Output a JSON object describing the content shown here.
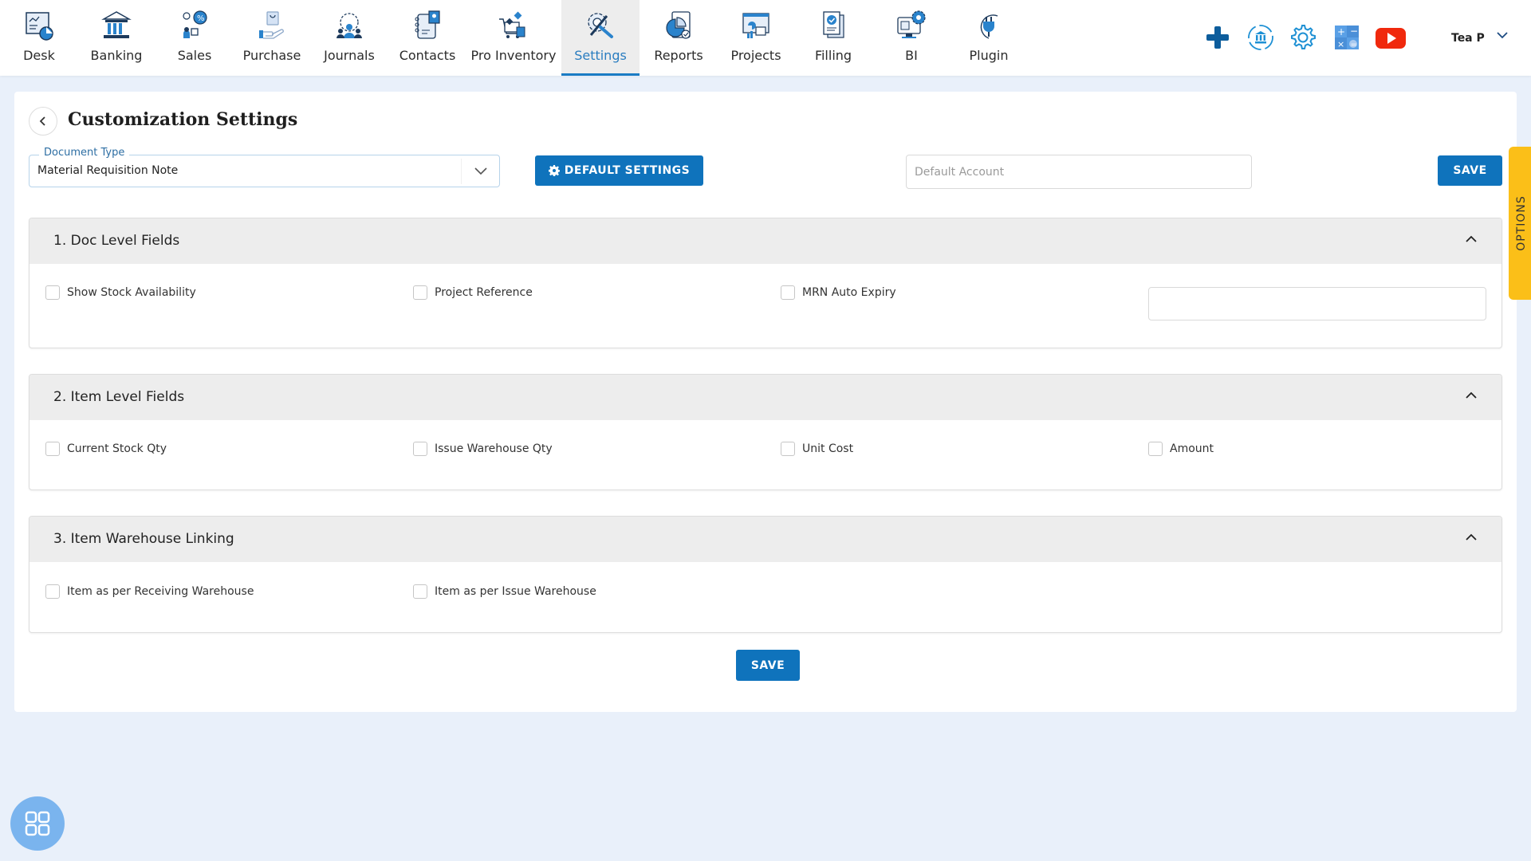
{
  "nav": {
    "items": [
      {
        "label": "Desk",
        "icon": "desk-icon"
      },
      {
        "label": "Banking",
        "icon": "bank-icon"
      },
      {
        "label": "Sales",
        "icon": "sales-icon"
      },
      {
        "label": "Purchase",
        "icon": "purchase-icon"
      },
      {
        "label": "Journals",
        "icon": "journals-icon"
      },
      {
        "label": "Contacts",
        "icon": "contacts-icon"
      },
      {
        "label": "Pro Inventory",
        "icon": "inventory-icon"
      },
      {
        "label": "Settings",
        "icon": "settings-icon",
        "active": true
      },
      {
        "label": "Reports",
        "icon": "reports-icon"
      },
      {
        "label": "Projects",
        "icon": "projects-icon"
      },
      {
        "label": "Filling",
        "icon": "filling-icon"
      },
      {
        "label": "BI",
        "icon": "bi-icon"
      },
      {
        "label": "Plugin",
        "icon": "plugin-icon"
      }
    ],
    "actions": [
      "add-icon",
      "bank-sync-icon",
      "gear-icon",
      "calculator-icon",
      "youtube-icon"
    ],
    "user_name": "Tea P",
    "accent": "#1a7cc4"
  },
  "page": {
    "title": "Customization Settings",
    "document_type": {
      "legend": "Document Type",
      "value": "Material Requisition Note"
    },
    "default_settings_label": "DEFAULT SETTINGS",
    "default_account": {
      "placeholder": "Default Account",
      "value": ""
    },
    "save_label": "SAVE",
    "options_label": "OPTIONS",
    "primary_color": "#0f73bc"
  },
  "sections": [
    {
      "title": "1. Doc Level Fields",
      "fields": [
        {
          "label": "Show Stock Availability",
          "checked": false
        },
        {
          "label": "Project Reference",
          "checked": false
        },
        {
          "label": "MRN Auto Expiry",
          "checked": false
        }
      ],
      "mrn_expiry_value": ""
    },
    {
      "title": "2. Item Level Fields",
      "fields": [
        {
          "label": "Current Stock Qty",
          "checked": false
        },
        {
          "label": "Issue Warehouse Qty",
          "checked": false
        },
        {
          "label": "Unit Cost",
          "checked": false
        },
        {
          "label": "Amount",
          "checked": false
        }
      ]
    },
    {
      "title": "3. Item Warehouse Linking",
      "fields": [
        {
          "label": "Item as per Receiving Warehouse",
          "checked": false
        },
        {
          "label": "Item as per Issue Warehouse",
          "checked": false
        }
      ]
    }
  ],
  "bottom_save_label": "SAVE"
}
